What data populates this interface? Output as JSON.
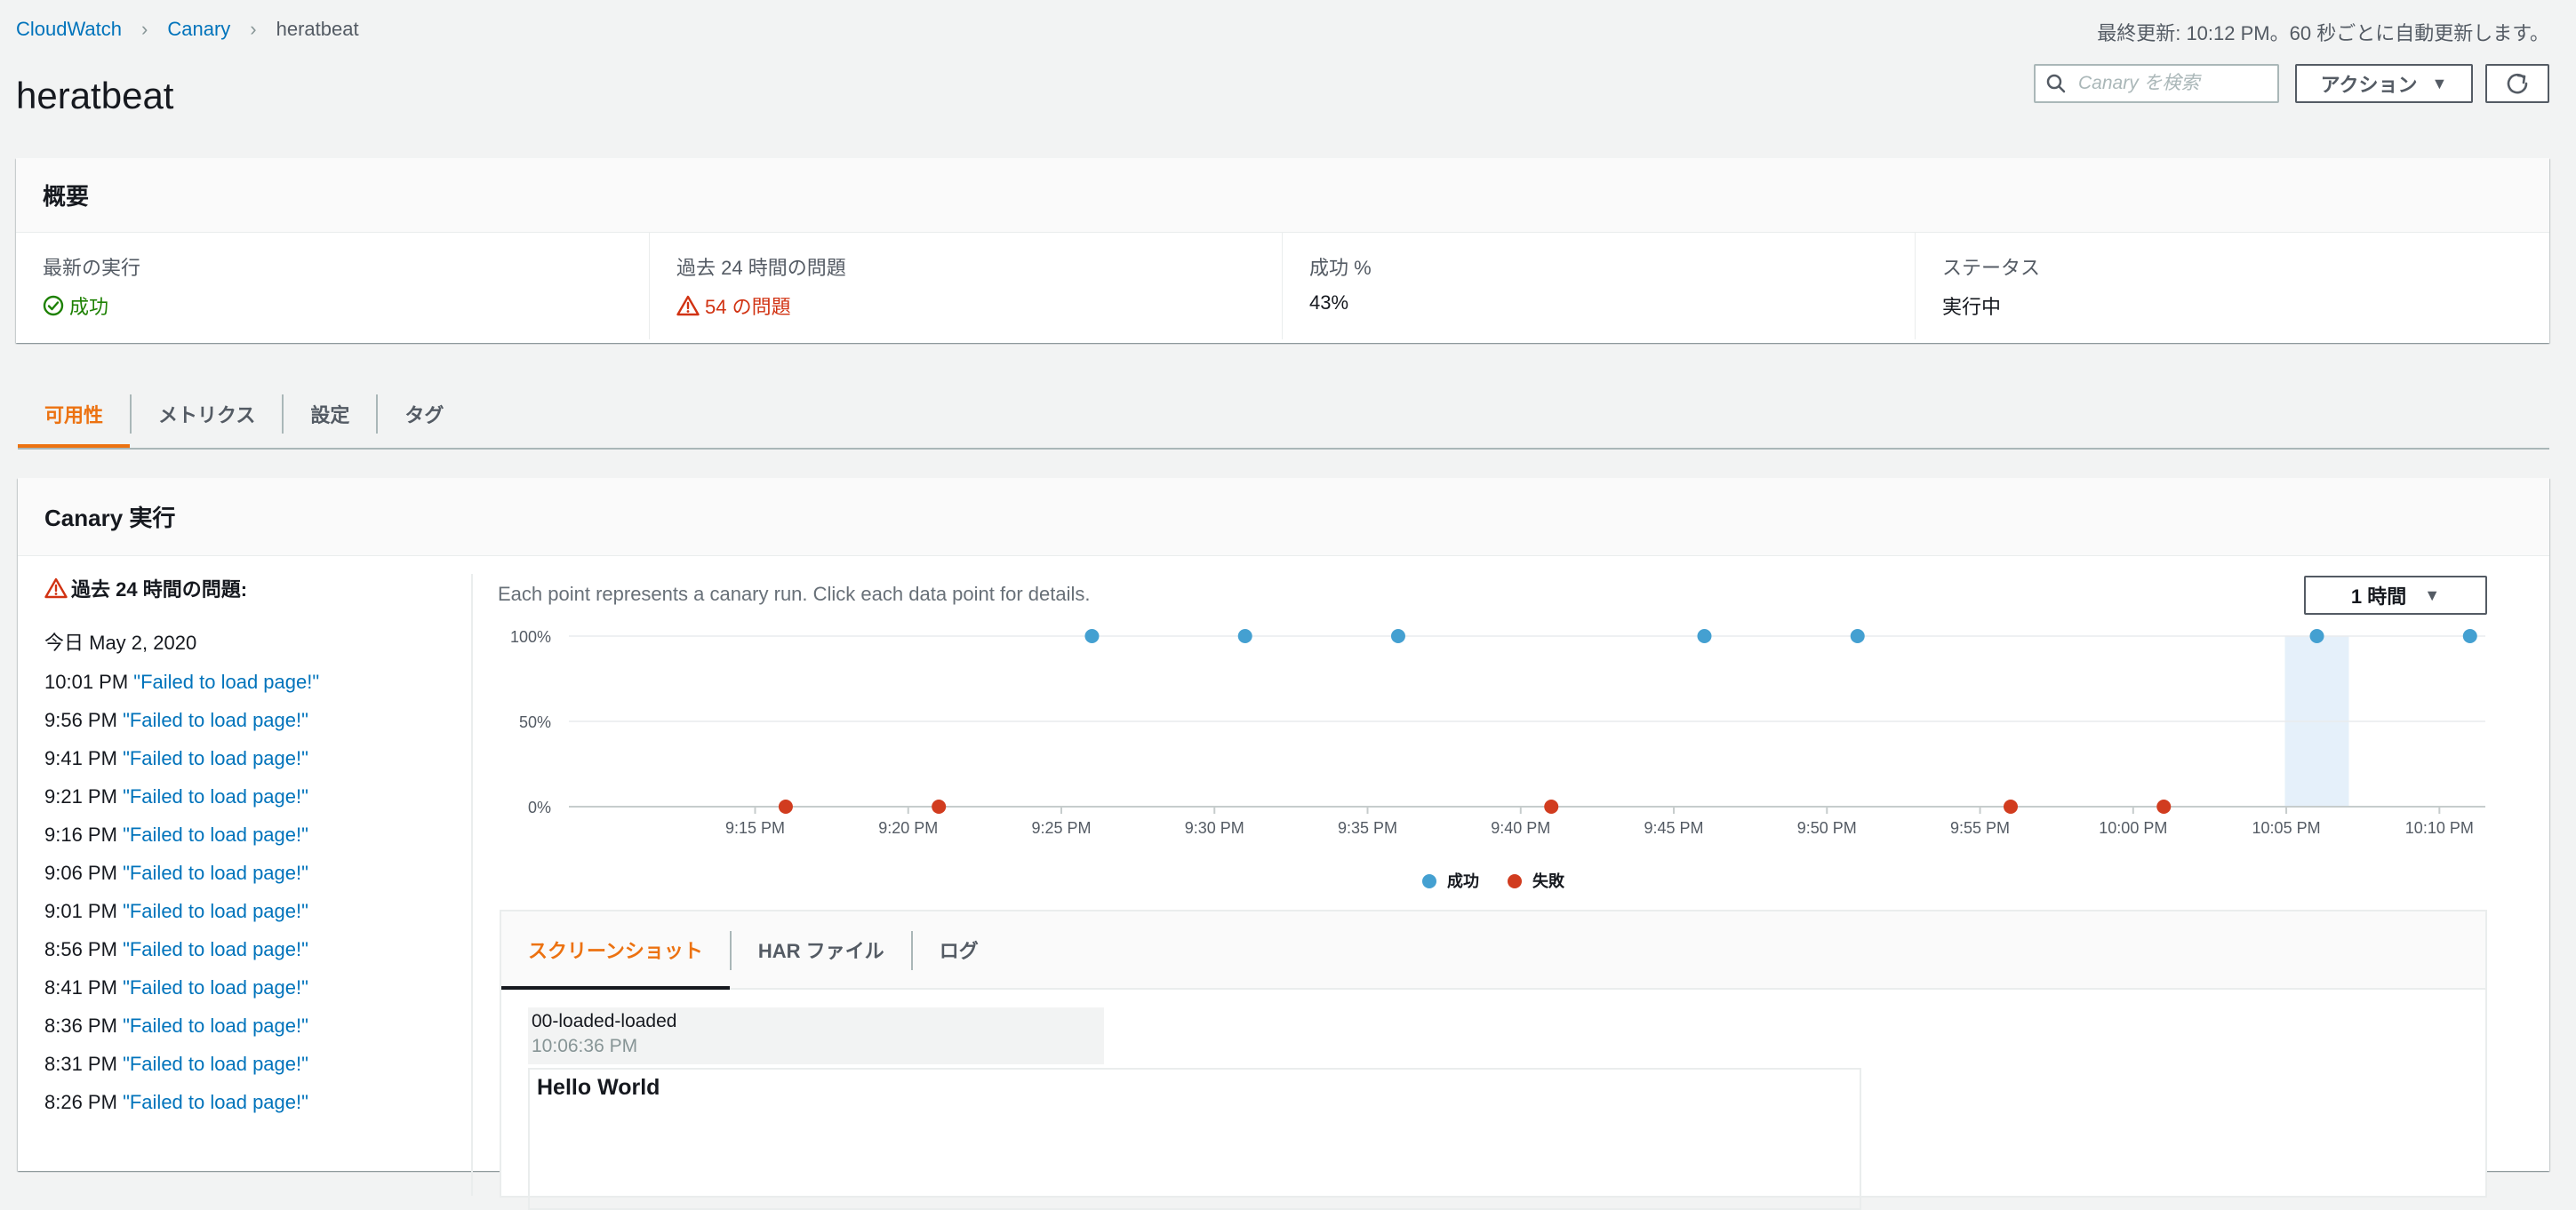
{
  "breadcrumb": {
    "items": [
      "CloudWatch",
      "Canary",
      "heratbeat"
    ]
  },
  "last_updated": "最終更新: 10:12 PM。60 秒ごとに自動更新します。",
  "page_title": "heratbeat",
  "search": {
    "placeholder": "Canary を検索",
    "icon": "search-icon"
  },
  "actions_button": {
    "label": "アクション"
  },
  "refresh_button": {
    "icon": "refresh-icon"
  },
  "overview": {
    "title": "概要",
    "latest_run": {
      "label": "最新の実行",
      "value": "成功"
    },
    "issues_24h": {
      "label": "過去 24 時間の問題",
      "value": "54 の問題"
    },
    "success_pct": {
      "label": "成功 %",
      "value": "43%"
    },
    "status": {
      "label": "ステータス",
      "value": "実行中"
    }
  },
  "tabs": [
    "可用性",
    "メトリクス",
    "設定",
    "タグ"
  ],
  "runs": {
    "title": "Canary 実行",
    "issues_title": "過去 24 時間の問題:",
    "issues_date": "今日 May 2, 2020",
    "issues": [
      {
        "time": "10:01 PM",
        "msg": "\"Failed to load page!\""
      },
      {
        "time": "9:56 PM",
        "msg": "\"Failed to load page!\""
      },
      {
        "time": "9:41 PM",
        "msg": "\"Failed to load page!\""
      },
      {
        "time": "9:21 PM",
        "msg": "\"Failed to load page!\""
      },
      {
        "time": "9:16 PM",
        "msg": "\"Failed to load page!\""
      },
      {
        "time": "9:06 PM",
        "msg": "\"Failed to load page!\""
      },
      {
        "time": "9:01 PM",
        "msg": "\"Failed to load page!\""
      },
      {
        "time": "8:56 PM",
        "msg": "\"Failed to load page!\""
      },
      {
        "time": "8:41 PM",
        "msg": "\"Failed to load page!\""
      },
      {
        "time": "8:36 PM",
        "msg": "\"Failed to load page!\""
      },
      {
        "time": "8:31 PM",
        "msg": "\"Failed to load page!\""
      },
      {
        "time": "8:26 PM",
        "msg": "\"Failed to load page!\""
      }
    ],
    "chart_desc": "Each point represents a canary run. Click each data point for details.",
    "range_label": "1 時間",
    "inner_tabs": [
      "スクリーンショット",
      "HAR ファイル",
      "ログ"
    ],
    "screenshot": {
      "name": "00-loaded-loaded",
      "time": "10:06:36 PM",
      "content": "Hello World"
    }
  },
  "chart_data": {
    "type": "scatter",
    "x_ticks": [
      "9:15 PM",
      "9:20 PM",
      "9:25 PM",
      "9:30 PM",
      "9:35 PM",
      "9:40 PM",
      "9:45 PM",
      "9:50 PM",
      "9:55 PM",
      "10:00 PM",
      "10:05 PM",
      "10:10 PM"
    ],
    "y_ticks": [
      "0%",
      "50%",
      "100%"
    ],
    "ylim": [
      0,
      100
    ],
    "xlim_minutes": [
      9.5,
      71.5
    ],
    "x_minutes_past_9pm_note": "",
    "series": [
      {
        "name": "成功",
        "color": "#44a0d1",
        "x": [
          "9:26 PM",
          "9:31 PM",
          "9:36 PM",
          "9:46 PM",
          "9:51 PM",
          "10:06 PM",
          "10:11 PM"
        ],
        "values": [
          100,
          100,
          100,
          100,
          100,
          100,
          100
        ]
      },
      {
        "name": "失敗",
        "color": "#d13c1f",
        "x": [
          "9:16 PM",
          "9:21 PM",
          "9:41 PM",
          "9:56 PM",
          "10:01 PM"
        ],
        "values": [
          0,
          0,
          0,
          0,
          0
        ]
      }
    ],
    "highlight_x": "10:06 PM",
    "grid": true,
    "legend": "bottom-center"
  }
}
